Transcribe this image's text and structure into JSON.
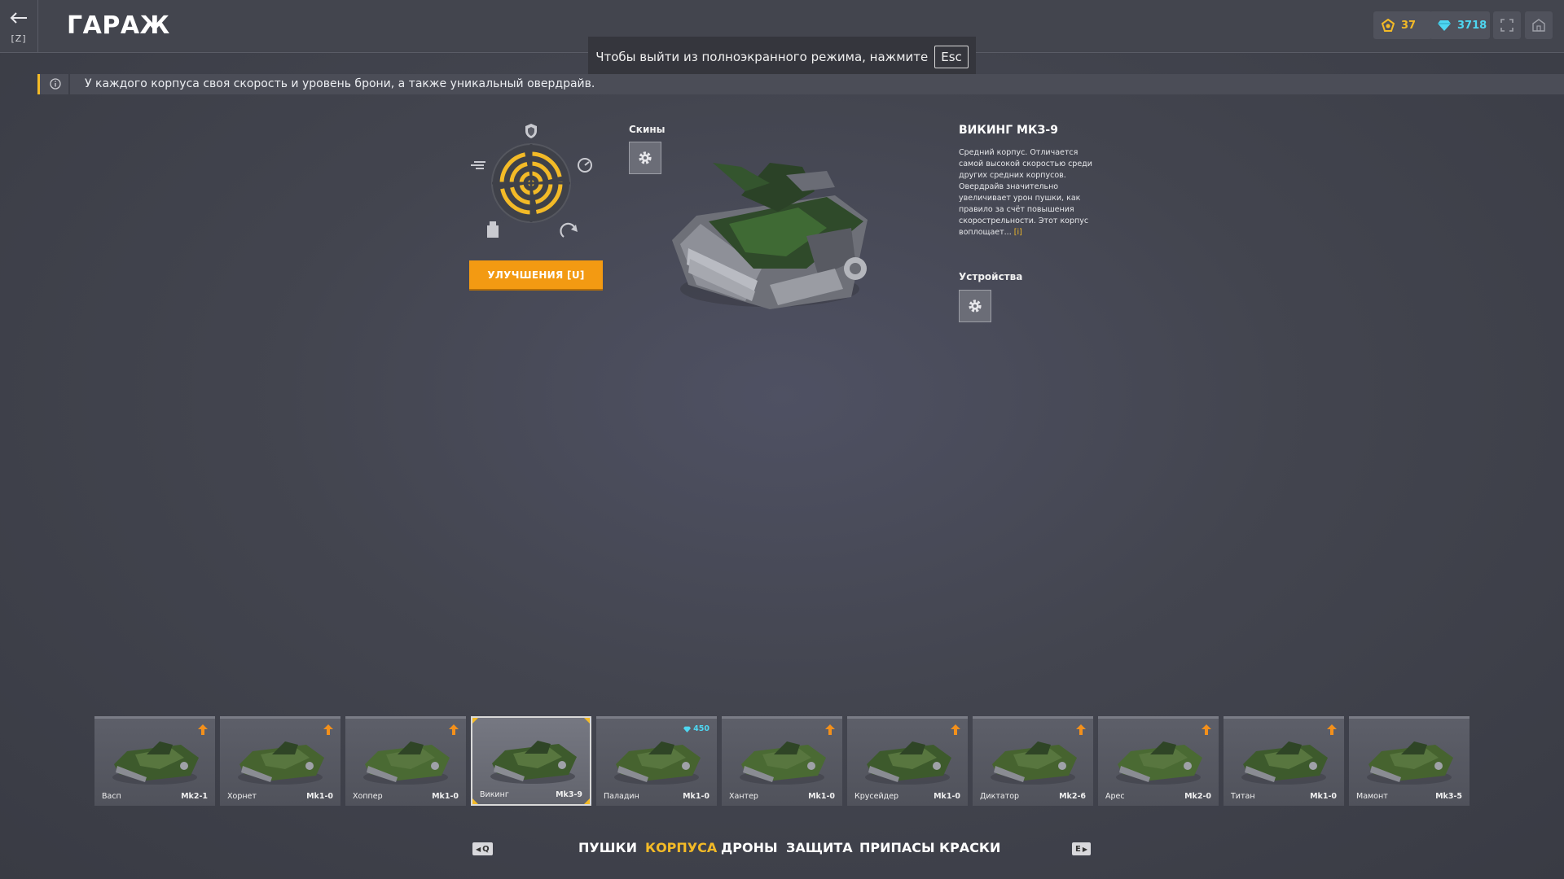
{
  "header": {
    "back_key": "[Z]",
    "title": "ГАРАЖ",
    "crystals": "37",
    "gems": "3718"
  },
  "fullscreen_notice": {
    "text": "Чтобы выйти из полноэкранного режима, нажмите",
    "key": "Esc"
  },
  "info": {
    "text": "У каждого корпуса своя скорость и уровень брони, а также уникальный овердрайв."
  },
  "upgrades": {
    "button_label": "УЛУЧШЕНИЯ [U]"
  },
  "skins": {
    "label": "Скины"
  },
  "devices": {
    "label": "Устройства"
  },
  "hull": {
    "name": "ВИКИНГ МКЗ-9",
    "description": "Средний корпус. Отличается самой высокой скоростью среди других средних корпусов. Овердрайв значительно увеличивает урон пушки, как правило за счёт повышения скорострельности. Этот корпус воплощает...",
    "more_link": "[i]"
  },
  "colors": {
    "accent": "#f3ba27",
    "button": "#f39a12",
    "gem": "#4ed7f2"
  },
  "carousel": [
    {
      "name": "Васп",
      "mk": "Mk2-1",
      "badge": "upgrade"
    },
    {
      "name": "Хорнет",
      "mk": "Mk1-0",
      "badge": "upgrade"
    },
    {
      "name": "Хоппер",
      "mk": "Mk1-0",
      "badge": "upgrade"
    },
    {
      "name": "Викинг",
      "mk": "Mk3-9",
      "badge": "selected"
    },
    {
      "name": "Паладин",
      "mk": "Mk1-0",
      "badge": "price",
      "price": "450"
    },
    {
      "name": "Хантер",
      "mk": "Mk1-0",
      "badge": "upgrade"
    },
    {
      "name": "Крусейдер",
      "mk": "Mk1-0",
      "badge": "upgrade"
    },
    {
      "name": "Диктатор",
      "mk": "Mk2-6",
      "badge": "upgrade"
    },
    {
      "name": "Арес",
      "mk": "Mk2-0",
      "badge": "upgrade"
    },
    {
      "name": "Титан",
      "mk": "Mk1-0",
      "badge": "upgrade"
    },
    {
      "name": "Мамонт",
      "mk": "Mk3-5",
      "badge": "none"
    }
  ],
  "nav": {
    "prev_key": "Q",
    "next_key": "E",
    "tabs": [
      {
        "label": "ПУШКИ",
        "active": false
      },
      {
        "label": "КОРПУСА",
        "active": true
      },
      {
        "label": "ДРОНЫ",
        "active": false
      },
      {
        "label": "ЗАЩИТА",
        "active": false
      },
      {
        "label": "ПРИПАСЫ",
        "active": false
      },
      {
        "label": "КРАСКИ",
        "active": false
      }
    ]
  }
}
